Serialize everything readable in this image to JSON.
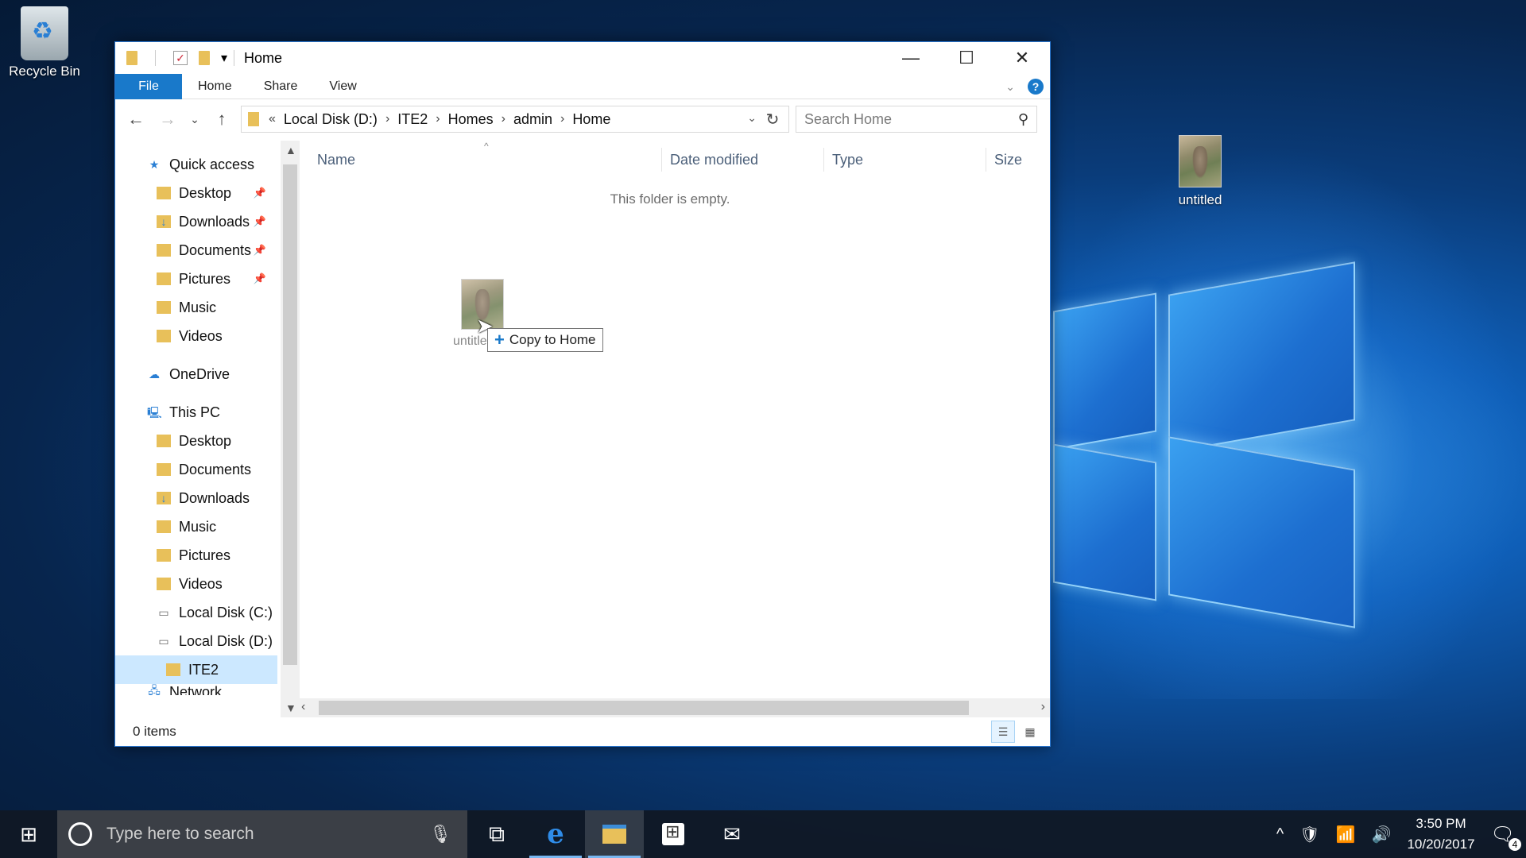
{
  "desktop": {
    "icons": [
      {
        "label": "Recycle Bin",
        "icon": "recycle-bin-icon"
      },
      {
        "label": "untitled",
        "icon": "image-thumbnail"
      }
    ]
  },
  "window": {
    "title": "Home",
    "quick_access_toolbar": [
      "folder-icon",
      "properties-check-icon",
      "new-folder-icon",
      "customize-dropdown-icon"
    ],
    "controls": {
      "minimize": "—",
      "maximize": "☐",
      "close": "✕"
    },
    "ribbon": {
      "tabs": [
        "File",
        "Home",
        "Share",
        "View"
      ],
      "active_tab": "File",
      "help": "?"
    },
    "nav": {
      "back": "←",
      "forward": "→",
      "recent": "⌄",
      "up": "↑",
      "breadcrumb_prefix": "«",
      "breadcrumb": [
        "Local Disk (D:)",
        "ITE2",
        "Homes",
        "admin",
        "Home"
      ],
      "refresh": "↻",
      "search_placeholder": "Search Home"
    },
    "sidebar": {
      "quick_access": {
        "label": "Quick access",
        "items": [
          {
            "label": "Desktop",
            "pinned": true
          },
          {
            "label": "Downloads",
            "pinned": true
          },
          {
            "label": "Documents",
            "pinned": true
          },
          {
            "label": "Pictures",
            "pinned": true
          },
          {
            "label": "Music",
            "pinned": false
          },
          {
            "label": "Videos",
            "pinned": false
          }
        ]
      },
      "onedrive": "OneDrive",
      "this_pc": {
        "label": "This PC",
        "items": [
          "Desktop",
          "Documents",
          "Downloads",
          "Music",
          "Pictures",
          "Videos",
          "Local Disk (C:)",
          "Local Disk (D:)"
        ]
      },
      "selected_folder": "ITE2",
      "partial_item": "Network"
    },
    "columns": [
      "Name",
      "Date modified",
      "Type",
      "Size"
    ],
    "empty_message": "This folder is empty.",
    "drag": {
      "file_label": "untitled",
      "tooltip": "Copy to Home",
      "tooltip_icon": "+"
    },
    "status": {
      "item_count": "0 items"
    }
  },
  "taskbar": {
    "search_placeholder": "Type here to search",
    "apps": [
      "task-view",
      "edge",
      "file-explorer",
      "store",
      "mail"
    ],
    "active_app": "file-explorer",
    "time": "3:50 PM",
    "date": "10/20/2017",
    "notification_count": "4"
  }
}
